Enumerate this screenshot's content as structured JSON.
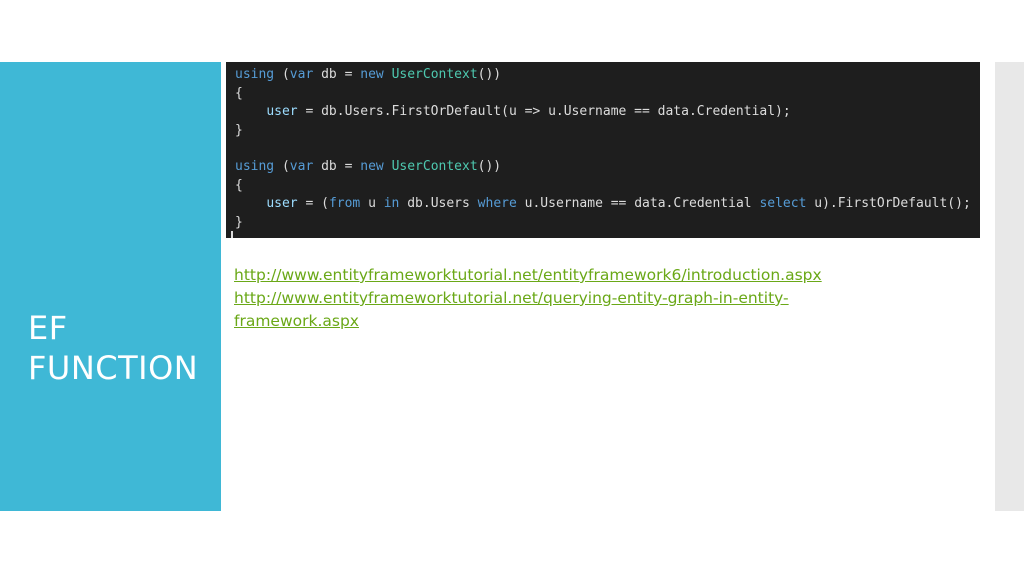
{
  "slide": {
    "title_lines": [
      "EF",
      "FUNCTION"
    ]
  },
  "code": {
    "block1": {
      "line1": [
        "using",
        " (",
        "var",
        " db = ",
        "new",
        " ",
        "UserContext",
        "())"
      ],
      "line2": "{",
      "line3": [
        "    ",
        "user",
        " = db.Users.FirstOrDefault(u => u.Username == data.Credential);"
      ],
      "line4": "}"
    },
    "block2": {
      "line1": [
        "using",
        " (",
        "var",
        " db = ",
        "new",
        " ",
        "UserContext",
        "())"
      ],
      "line2": "{",
      "line3": [
        "    ",
        "user",
        " = (",
        "from",
        " u ",
        "in",
        " db.Users ",
        "where",
        " u.Username == data.Credential ",
        "select",
        " u).FirstOrDefault();"
      ],
      "line4": "}"
    }
  },
  "links": [
    "http://www.entityframeworktutorial.net/entityframework6/introduction.aspx",
    "http://www.entityframeworktutorial.net/querying-entity-graph-in-entity-framework.aspx"
  ],
  "colors": {
    "sidebar": "#3fb8d6",
    "code_background": "#1e1e1e",
    "keyword": "#569cd6",
    "type": "#4ec9b0",
    "link": "#6aa817"
  }
}
